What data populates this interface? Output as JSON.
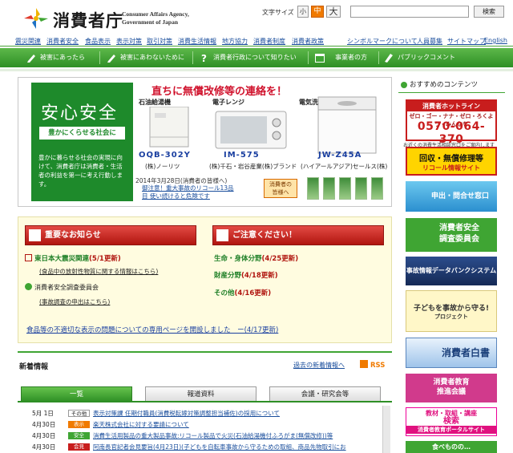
{
  "header": {
    "logo_name": "消費者庁",
    "logo_en_1": "Consumer Affairs Agency,",
    "logo_en_2": "Government of Japan",
    "font_size_label": "文字サイズ",
    "font_size_small": "小",
    "font_size_medium": "中",
    "font_size_large": "大",
    "search_placeholder": "",
    "search_button": "検索"
  },
  "top_nav": [
    "震災関連",
    "消費者安全",
    "食品表示",
    "表示対策",
    "取引対策",
    "消費生活情報",
    "地方協力",
    "消費者制度",
    "消費者政策",
    "シンボルマークについて",
    "人員募集",
    "サイトマップ",
    "English"
  ],
  "green_bar": [
    "被害にあったら",
    "被害にあわないために",
    "消費者行政について知りたい",
    "事業者の方",
    "パブリックコメント"
  ],
  "hero": {
    "title": "安心安全",
    "subtitle": "豊かにくらせる社会に",
    "body": "豊かに暮らせる社会の実現に向けて、消費者庁は消費者・生活者の利益を第一に考え行動します。",
    "headline": "直ちに無償改修等の連絡を！",
    "products": [
      {
        "label": "石油給湯機",
        "model": "OQB-302Y",
        "maker": "(株)ノーリツ"
      },
      {
        "label": "電子レンジ",
        "model": "IM-575",
        "maker": "(株)千石・岩谷産業(株)ブランド"
      },
      {
        "label": "電気洗濯機",
        "model": "JW-Z45A",
        "maker": "(ハイアールアジア)セールス(株)"
      }
    ],
    "date_text": "2014年3月28日(消費者の皆様へ)",
    "note_1": "御注意！重大事故のリコール13品",
    "note_2": "目 使い続けると危険です",
    "contact_1": "消費者の",
    "contact_2": "皆様へ"
  },
  "notices": {
    "important_head": "重要なお知らせ",
    "caution_head": "ご注意ください！",
    "items_left": [
      {
        "title": "東日本大震災関連",
        "update": "(5/1更新)",
        "sub": "(食品中の放射性物質に関する情報はこちら)"
      },
      {
        "title": "消費者安全調査委員会",
        "update": "",
        "sub": "(事故調査の申出はこちら)"
      }
    ],
    "items_right": [
      {
        "title": "生命・身体分野",
        "update": "(4/25更新)"
      },
      {
        "title": "財産分野",
        "update": "(4/18更新)"
      },
      {
        "title": "その他",
        "update": "(4/16更新)"
      }
    ],
    "bottom": "食品等の不適切な表示の問題についての専用ページを開設しました　ー(4/17更新)"
  },
  "news": {
    "title": "新着情報",
    "archive_link": "過去の新着情報へ",
    "rss_label": "RSS",
    "tabs": [
      "一覧",
      "報道資料",
      "会議・研究会等"
    ],
    "rows": [
      {
        "date": "5月 1日",
        "badge": "その他",
        "badge_color": "#ffffff",
        "text": "表示対策課 任期付職員(消費税転嫁対策調整担当補佐)の採用について"
      },
      {
        "date": "4月30日",
        "badge": "表示",
        "badge_color": "#f07a00",
        "text": "楽天株式会社に対する要請について"
      },
      {
        "date": "4月30日",
        "badge": "安全",
        "badge_color": "#3fa533",
        "text": "消費生活用製品の重大製品事故:リコール製品で火災(石油給湯機付ふろがま(無償改修))等"
      },
      {
        "date": "4月30日",
        "badge": "会見",
        "badge_color": "#c81d1d",
        "text": "阿南長官記者会見要旨(4月23日)(子どもを自転車事故から守るための取組、商品先物取引にお"
      }
    ]
  },
  "right_col": {
    "head": "おすすめのコンテンツ",
    "hotline_title": "消費者ホットライン",
    "hotline_slogan": "ゼロ・ゴー・ナナ・ゼロ・ろくよう・みんなを",
    "hotline_number": "0570-064-370",
    "hotline_note": "お近くの消費生活相談窓口をご案内します",
    "banners": [
      {
        "line1": "回収・無償修理等",
        "line2": "リコール情報サイト"
      },
      {
        "line1": "申出・問合せ窓口",
        "line2": ""
      },
      {
        "line1": "消費者安全",
        "line2": "調査委員会"
      },
      {
        "line1": "事故情報データバンクシステム",
        "line2": ""
      },
      {
        "line1": "子どもを事故から守る!",
        "line2": "プロジェクト"
      },
      {
        "line1": "消費者白書",
        "line2": ""
      },
      {
        "line1": "消費者教育",
        "line2": "推進会議"
      },
      {
        "line1": "教材・取組・講座",
        "line2": "検索"
      },
      {
        "line1": "消費者教育ポータルサイト",
        "line2": ""
      },
      {
        "line1": "食べものの…",
        "line2": ""
      }
    ]
  }
}
